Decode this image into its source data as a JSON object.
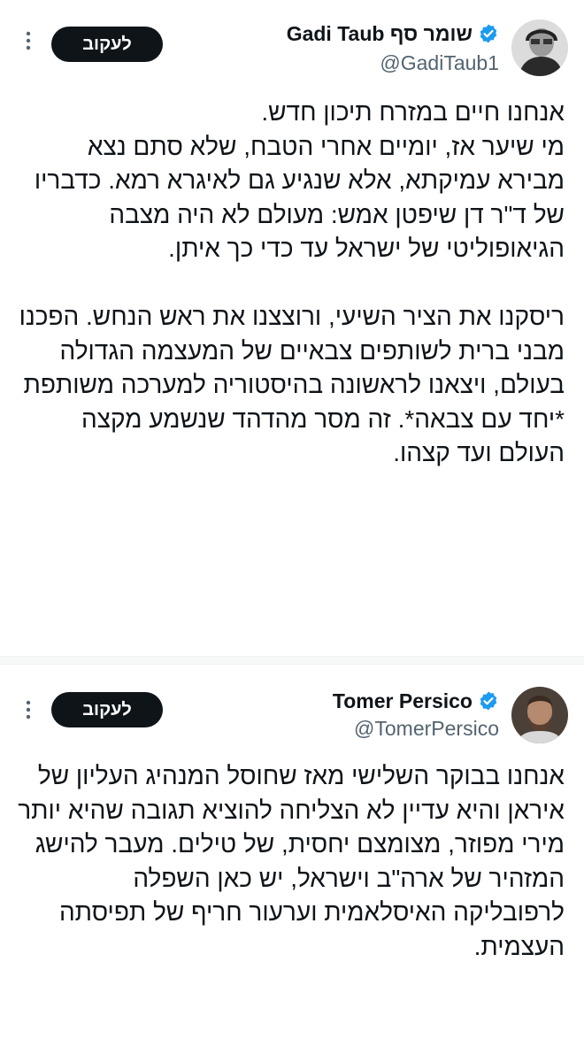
{
  "tweet1": {
    "display_name": "שומר סף Gadi Taub",
    "handle": "@GadiTaub1",
    "follow_label": "לעקוב",
    "avatar_icon": "person-avatar-icon",
    "verified_color": "#1d9bf0",
    "body": "אנחנו חיים במזרח תיכון חדש.\nמי שיער אז, יומיים אחרי הטבח, שלא סתם נצא מבירא עמיקתא, אלא שנגיע גם לאיגרא רמא. כדבריו של ד\"ר דן שיפטן אמש: מעולם לא היה מצבה הגיאופוליטי של ישראל עד כדי כך איתן.\n\nריסקנו את הציר השיעי, ורוצצנו את ראש הנחש. הפכנו מבני ברית לשותפים צבאיים של המעצמה הגדולה בעולם, ויצאנו לראשונה בהיסטוריה למערכה משותפת *יחד עם צבאה*. זה מסר מהדהד שנשמע מקצה העולם ועד קצהו."
  },
  "tweet2": {
    "display_name": "Tomer Persico",
    "handle": "@TomerPersico",
    "follow_label": "לעקוב",
    "avatar_icon": "person-avatar-icon",
    "verified_color": "#1d9bf0",
    "body": "אנחנו בבוקר השלישי מאז שחוסל המנהיג העליון של איראן והיא עדיין לא הצליחה להוציא תגובה שהיא יותר מירי מפוזר, מצומצם יחסית, של טילים. מעבר להישג המזהיר של ארה\"ב וישראל, יש כאן השפלה לרפובליקה האיסלאמית וערעור חריף של תפיסתה העצמית."
  }
}
